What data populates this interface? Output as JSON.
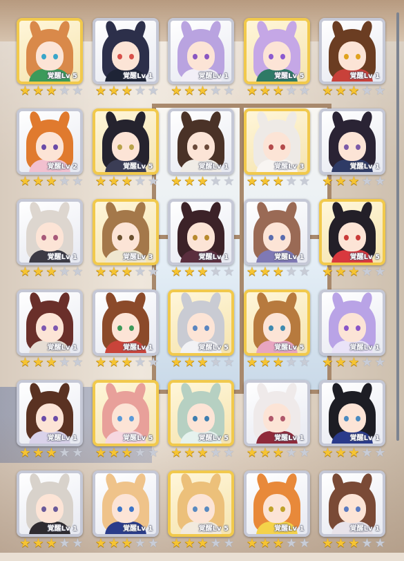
{
  "theme": {
    "gold_frame": "#f1c94c",
    "silver_frame": "#c5c8d6",
    "star_on": "#f6c432",
    "star_off": "#c8ccd6"
  },
  "star_icon": "star-icon",
  "characters": [
    {
      "level": "覚醒Lv 5",
      "stars": 3,
      "frame": "gold",
      "hair": "#d9894a",
      "eye": "#3aa6c9",
      "outfit": "#3b9a5a"
    },
    {
      "level": "覚醒Lv 1",
      "stars": 3,
      "frame": "silver",
      "hair": "#2c2f4a",
      "eye": "#d8504a",
      "outfit": "#1e2436"
    },
    {
      "level": "覚醒Lv 1",
      "stars": 3,
      "frame": "silver",
      "hair": "#b9a3e0",
      "eye": "#8a57c2",
      "outfit": "#f2eff7"
    },
    {
      "level": "覚醒Lv 5",
      "stars": 3,
      "frame": "gold",
      "hair": "#c5a7e6",
      "eye": "#8c5ad0",
      "outfit": "#2e7a66"
    },
    {
      "level": "覚醒Lv 1",
      "stars": 3,
      "frame": "silver",
      "hair": "#6b3d22",
      "eye": "#e0a21e",
      "outfit": "#c8413a"
    },
    {
      "level": "覚醒Lv 2",
      "stars": 3,
      "frame": "silver",
      "hair": "#e07a2e",
      "eye": "#6a4ba8",
      "outfit": "#f2c0cf"
    },
    {
      "level": "覚醒Lv 5",
      "stars": 3,
      "frame": "gold",
      "hair": "#25232e",
      "eye": "#b9a34a",
      "outfit": "#3b3d55"
    },
    {
      "level": "覚醒Lv 1",
      "stars": 3,
      "frame": "silver",
      "hair": "#4a3227",
      "eye": "#6b4a3a",
      "outfit": "#f0ece6"
    },
    {
      "level": "覚醒Lv 3",
      "stars": 3,
      "frame": "gold",
      "hair": "#eeeae6",
      "eye": "#b44b4b",
      "outfit": "#f8f5f2"
    },
    {
      "level": "覚醒Lv 1",
      "stars": 3,
      "frame": "silver",
      "hair": "#2a2334",
      "eye": "#7c5aa8",
      "outfit": "#2f3b66"
    },
    {
      "level": "覚醒Lv 1",
      "stars": 3,
      "frame": "silver",
      "hair": "#ddd6cf",
      "eye": "#a85a7a",
      "outfit": "#3c3a44"
    },
    {
      "level": "覚醒Lv 3",
      "stars": 3,
      "frame": "gold",
      "hair": "#a4784a",
      "eye": "#6b5130",
      "outfit": "#efe7cf"
    },
    {
      "level": "覚醒Lv 1",
      "stars": 3,
      "frame": "silver",
      "hair": "#3c2228",
      "eye": "#b88a2e",
      "outfit": "#5a2e3e"
    },
    {
      "level": "覚醒Lv 1",
      "stars": 3,
      "frame": "silver",
      "hair": "#9a6a55",
      "eye": "#5a6cae",
      "outfit": "#7f79b4"
    },
    {
      "level": "覚醒Lv 5",
      "stars": 3,
      "frame": "gold",
      "hair": "#231f28",
      "eye": "#c93a3a",
      "outfit": "#d8383e"
    },
    {
      "level": "覚醒Lv 1",
      "stars": 3,
      "frame": "silver",
      "hair": "#6a2f2a",
      "eye": "#7d57b0",
      "outfit": "#e6ddd4"
    },
    {
      "level": "覚醒Lv 1",
      "stars": 3,
      "frame": "silver",
      "hair": "#8b4a2a",
      "eye": "#3d9a5a",
      "outfit": "#c9443a"
    },
    {
      "level": "覚醒Lv 5",
      "stars": 3,
      "frame": "gold",
      "hair": "#c9cbd3",
      "eye": "#5a86c0",
      "outfit": "#f2f2f5"
    },
    {
      "level": "覚醒Lv 5",
      "stars": 3,
      "frame": "gold",
      "hair": "#b77a3e",
      "eye": "#3f8ab0",
      "outfit": "#e8a5c0"
    },
    {
      "level": "覚醒Lv 1",
      "stars": 3,
      "frame": "silver",
      "hair": "#b9a3e6",
      "eye": "#8a55c8",
      "outfit": "#eae3f8"
    },
    {
      "level": "覚醒Lv 1",
      "stars": 3,
      "frame": "silver",
      "hair": "#5a3222",
      "eye": "#6a4ba8",
      "outfit": "#d9d2ea"
    },
    {
      "level": "覚醒Lv 5",
      "stars": 3,
      "frame": "gold",
      "hair": "#e8a09a",
      "eye": "#5a9ad8",
      "outfit": "#f6d7e0"
    },
    {
      "level": "覚醒Lv 5",
      "stars": 3,
      "frame": "gold",
      "hair": "#b6d0c2",
      "eye": "#3d7eb0",
      "outfit": "#e6f2ee"
    },
    {
      "level": "覚醒Lv 1",
      "stars": 3,
      "frame": "silver",
      "hair": "#efeaea",
      "eye": "#b0576a",
      "outfit": "#8f2a3a"
    },
    {
      "level": "覚醒Lv 1",
      "stars": 3,
      "frame": "silver",
      "hair": "#1d1d24",
      "eye": "#4a8ac0",
      "outfit": "#2a3a8a"
    },
    {
      "level": "覚醒Lv 1",
      "stars": 3,
      "frame": "silver",
      "hair": "#d8d2cb",
      "eye": "#6a5a9a",
      "outfit": "#2e2b30"
    },
    {
      "level": "覚醒Lv 1",
      "stars": 3,
      "frame": "silver",
      "hair": "#efc38a",
      "eye": "#3c74c8",
      "outfit": "#2a3c8a"
    },
    {
      "level": "覚醒Lv 5",
      "stars": 3,
      "frame": "gold",
      "hair": "#ecc07a",
      "eye": "#5a8ac0",
      "outfit": "#f2eadd"
    },
    {
      "level": "覚醒Lv 1",
      "stars": 3,
      "frame": "silver",
      "hair": "#e8893a",
      "eye": "#c0a22a",
      "outfit": "#f4d24a"
    },
    {
      "level": "覚醒Lv 1",
      "stars": 3,
      "frame": "silver",
      "hair": "#7a4a36",
      "eye": "#5a7ac0",
      "outfit": "#e8e3ea"
    }
  ]
}
